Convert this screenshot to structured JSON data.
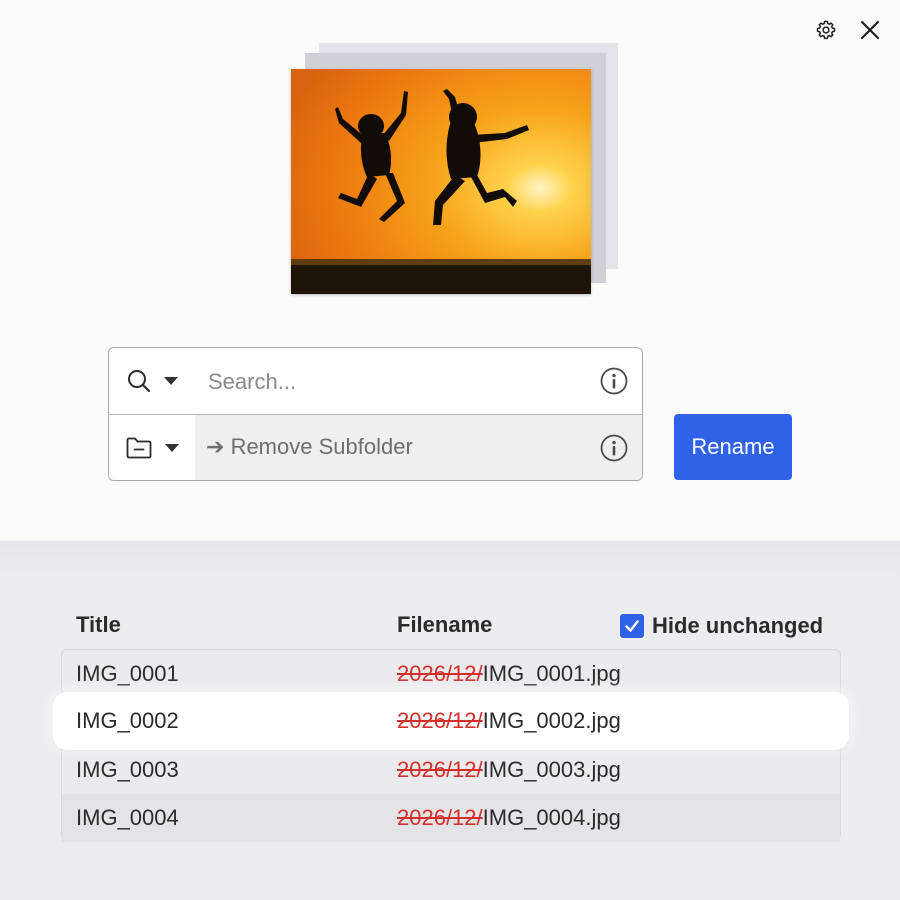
{
  "toolbar": {
    "settings_icon": "gear-icon",
    "close_icon": "close-icon"
  },
  "preview": {
    "image_description_icon": "photo-stack"
  },
  "search": {
    "placeholder": "Search...",
    "mode_icon": "search-icon",
    "info_icon": "info-icon"
  },
  "rule": {
    "arrow": "➔",
    "label": "Remove Subfolder",
    "mode_icon": "folder-minus-icon",
    "info_icon": "info-icon"
  },
  "rename_button": "Rename",
  "table": {
    "columns": [
      "Title",
      "Filename"
    ],
    "hide_unchanged": {
      "label": "Hide unchanged",
      "checked": true
    },
    "rows": [
      {
        "title": "IMG_0001",
        "removed": "2026/12/",
        "filename": "IMG_0001.jpg"
      },
      {
        "title": "IMG_0002",
        "removed": "2026/12/",
        "filename": "IMG_0002.jpg"
      },
      {
        "title": "IMG_0003",
        "removed": "2026/12/",
        "filename": "IMG_0003.jpg"
      },
      {
        "title": "IMG_0004",
        "removed": "2026/12/",
        "filename": "IMG_0004.jpg"
      }
    ]
  },
  "colors": {
    "accent": "#2f62e8",
    "removed_text": "#d3302b"
  }
}
